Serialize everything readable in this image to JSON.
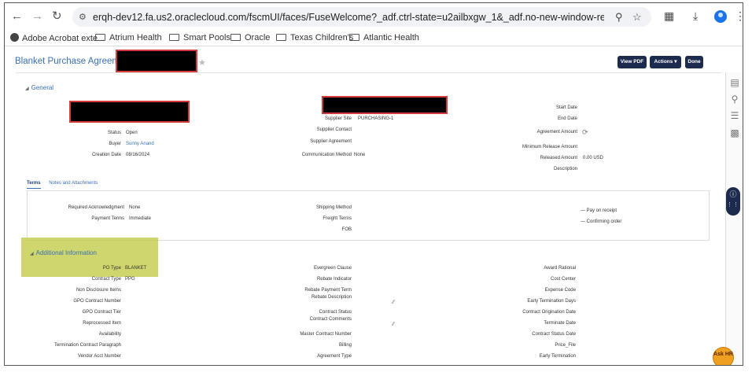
{
  "browser": {
    "url": "erqh-dev12.fa.us2.oraclecloud.com/fscmUI/faces/FuseWelcome?_adf.ctrl-state=u2ailbxgw_1&_adf.no-new-window-redirect=true&_afrLoop...",
    "bookmarks": [
      {
        "label": "Adobe Acrobat exte..."
      },
      {
        "label": "Atrium Health"
      },
      {
        "label": "Smart Pools"
      },
      {
        "label": "Oracle"
      },
      {
        "label": "Texas Children's"
      },
      {
        "label": "Atlantic Health"
      }
    ]
  },
  "header": {
    "title": "Blanket Purchase Agreement",
    "view_pdf": "View PDF",
    "actions": "Actions ▾",
    "done": "Done"
  },
  "general": {
    "heading": "General",
    "status_label": "Status",
    "status_value": "Open",
    "buyer_label": "Buyer",
    "buyer_value": "Sunny Anand",
    "creation_date_label": "Creation Date",
    "creation_date_value": "08/16/2024",
    "supplier_site_label": "Supplier Site",
    "supplier_site_value": "PURCHASING-1",
    "supplier_contact_label": "Supplier Contact",
    "supplier_agreement_label": "Supplier Agreement",
    "communication_method_label": "Communication Method",
    "communication_method_value": "None",
    "start_date_label": "Start Date",
    "end_date_label": "End Date",
    "agreement_amount_label": "Agreement Amount",
    "minimum_release_label": "Minimum Release Amount",
    "released_amount_label": "Released Amount",
    "released_amount_value": "0.00 USD",
    "description_label": "Description"
  },
  "tabs": [
    "Terms",
    "Notes and Attachments"
  ],
  "terms": {
    "required_ack_label": "Required Acknowledgment",
    "required_ack_value": "None",
    "payment_terms_label": "Payment Terms",
    "payment_terms_value": "Immediate",
    "shipping_method_label": "Shipping Method",
    "freight_terms_label": "Freight Terms",
    "fob_label": "FOB",
    "pay_on_receipt": "Pay on receipt",
    "confirming_order": "Confirming order"
  },
  "additional": {
    "heading": "Additional Information",
    "left": [
      {
        "label": "PO Type",
        "value": "BLANKET"
      },
      {
        "label": "Contract Type",
        "value": "PPG"
      },
      {
        "label": "Non Disclosure Items",
        "value": ""
      },
      {
        "label": "GPO Contract Number",
        "value": ""
      },
      {
        "label": "GPO Contract Tier",
        "value": ""
      },
      {
        "label": "Reprocessed Item",
        "value": ""
      },
      {
        "label": "Availability",
        "value": ""
      },
      {
        "label": "Termination Contract Paragraph",
        "value": ""
      },
      {
        "label": "Vendor Acct Number",
        "value": ""
      }
    ],
    "middle": [
      "Evergreen Clause",
      "Rebate Indicator",
      "Rebate Payment Term",
      "Rebate Description",
      "Contract Status",
      "Contract Comments",
      "Master Contract Number",
      "Billing",
      "Agreement Type"
    ],
    "right": [
      "Award Rational",
      "Cost Center",
      "Expense Code",
      "Early Termination Days",
      "Contract Origination Date",
      "Terminate Date",
      "Contract Status Date",
      "Price_File",
      "Early Termination"
    ]
  },
  "askhr": "Ask HR"
}
